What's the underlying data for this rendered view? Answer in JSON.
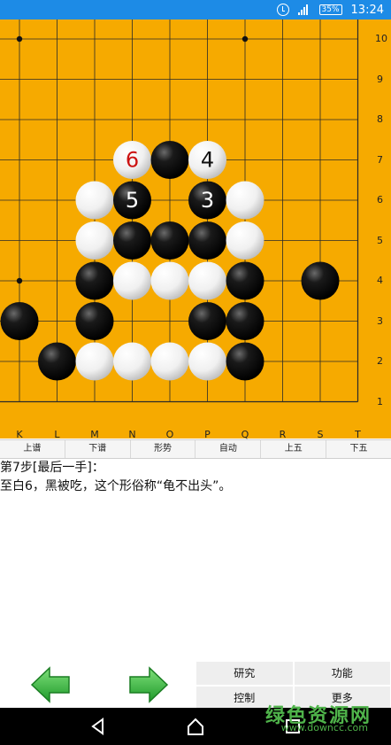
{
  "status_bar": {
    "battery": "35%",
    "time": "13:24"
  },
  "board": {
    "col_labels": [
      "K",
      "L",
      "M",
      "N",
      "O",
      "P",
      "Q",
      "R",
      "S",
      "T"
    ],
    "row_labels": [
      "10",
      "9",
      "8",
      "7",
      "6",
      "5",
      "4",
      "3",
      "2",
      "1"
    ],
    "stones": [
      {
        "c": "N",
        "r": 7,
        "color": "white",
        "num": "6"
      },
      {
        "c": "O",
        "r": 7,
        "color": "black",
        "num": ""
      },
      {
        "c": "P",
        "r": 7,
        "color": "white",
        "num": "4"
      },
      {
        "c": "M",
        "r": 6,
        "color": "white",
        "num": ""
      },
      {
        "c": "N",
        "r": 6,
        "color": "black",
        "num": "5"
      },
      {
        "c": "P",
        "r": 6,
        "color": "black",
        "num": "3"
      },
      {
        "c": "Q",
        "r": 6,
        "color": "white",
        "num": ""
      },
      {
        "c": "M",
        "r": 5,
        "color": "white",
        "num": ""
      },
      {
        "c": "N",
        "r": 5,
        "color": "black",
        "num": ""
      },
      {
        "c": "O",
        "r": 5,
        "color": "black",
        "num": ""
      },
      {
        "c": "P",
        "r": 5,
        "color": "black",
        "num": ""
      },
      {
        "c": "Q",
        "r": 5,
        "color": "white",
        "num": ""
      },
      {
        "c": "M",
        "r": 4,
        "color": "black",
        "num": ""
      },
      {
        "c": "N",
        "r": 4,
        "color": "white",
        "num": ""
      },
      {
        "c": "O",
        "r": 4,
        "color": "white",
        "num": ""
      },
      {
        "c": "P",
        "r": 4,
        "color": "white",
        "num": ""
      },
      {
        "c": "Q",
        "r": 4,
        "color": "black",
        "num": ""
      },
      {
        "c": "S",
        "r": 4,
        "color": "black",
        "num": ""
      },
      {
        "c": "K",
        "r": 3,
        "color": "black",
        "num": ""
      },
      {
        "c": "M",
        "r": 3,
        "color": "black",
        "num": ""
      },
      {
        "c": "P",
        "r": 3,
        "color": "black",
        "num": ""
      },
      {
        "c": "Q",
        "r": 3,
        "color": "black",
        "num": ""
      },
      {
        "c": "L",
        "r": 2,
        "color": "black",
        "num": ""
      },
      {
        "c": "M",
        "r": 2,
        "color": "white",
        "num": ""
      },
      {
        "c": "N",
        "r": 2,
        "color": "white",
        "num": ""
      },
      {
        "c": "O",
        "r": 2,
        "color": "white",
        "num": ""
      },
      {
        "c": "P",
        "r": 2,
        "color": "white",
        "num": ""
      },
      {
        "c": "Q",
        "r": 2,
        "color": "black",
        "num": ""
      }
    ],
    "hoshi": [
      {
        "c": "K",
        "r": 10
      },
      {
        "c": "Q",
        "r": 10
      },
      {
        "c": "K",
        "r": 4
      }
    ],
    "last_move_color": "#cc1111"
  },
  "toolbar": {
    "prev": "上谱",
    "next": "下谱",
    "situation": "形势",
    "auto": "自动",
    "prev5": "上五",
    "next5": "下五"
  },
  "comment": {
    "line1": "第7步[最后一手]：",
    "line2": "至白6，黑被吃，这个形俗称“龟不出头”。"
  },
  "menu": {
    "research": "研究",
    "function": "功能",
    "control": "控制",
    "more": "更多"
  },
  "watermark": {
    "title": "绿色资源网",
    "url": "www.downcc.com"
  }
}
